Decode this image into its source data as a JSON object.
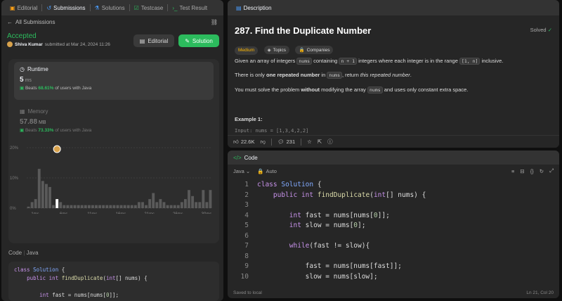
{
  "left_tabs": [
    {
      "label": "Editorial",
      "icon": "book-icon"
    },
    {
      "label": "Submissions",
      "icon": "history-icon"
    },
    {
      "label": "Solutions",
      "icon": "flask-icon"
    },
    {
      "label": "Testcase",
      "icon": "checkbox-icon"
    },
    {
      "label": "Test Result",
      "icon": "terminal-icon"
    }
  ],
  "all_submissions": "All Submissions",
  "submission": {
    "status": "Accepted",
    "author": "Shiva Kumar",
    "submitted_text": "submitted at Mar 24, 2024 11:26"
  },
  "buttons": {
    "editorial": "Editorial",
    "solution": "Solution"
  },
  "runtime": {
    "label": "Runtime",
    "value": "5",
    "unit": "ms",
    "beats_prefix": "Beats",
    "beats_pct": "68.61%",
    "beats_suffix": "of users with Java"
  },
  "memory": {
    "label": "Memory",
    "value": "57.88",
    "unit": "MB",
    "beats_prefix": "Beats",
    "beats_pct": "73.33%",
    "beats_suffix": "of users with Java"
  },
  "chart_data": {
    "type": "bar",
    "yticks": [
      "20%",
      "10%",
      "0%"
    ],
    "xticks": [
      "1ms",
      "6ms",
      "11ms",
      "16ms",
      "21ms",
      "26ms",
      "30ms"
    ],
    "mini_xticks": [
      "1ms",
      "11ms",
      "21ms",
      "31ms"
    ],
    "values": [
      0.5,
      2,
      3,
      13,
      9,
      8,
      7,
      1,
      3,
      2,
      1,
      1,
      1,
      1,
      1,
      1,
      1,
      1,
      1,
      1,
      1,
      1,
      1,
      1,
      1,
      1,
      1,
      1,
      1,
      1,
      1,
      2,
      2,
      1,
      3,
      5,
      2,
      3,
      2,
      1,
      1,
      1,
      1,
      2,
      3,
      6,
      4,
      2,
      2,
      6,
      2,
      6
    ],
    "highlight_index": 8,
    "ylim": [
      0,
      20
    ]
  },
  "code_section": {
    "label": "Code",
    "lang": "Java"
  },
  "code_preview": [
    "class Solution {",
    "    public int findDuplicate(int[] nums) {",
    "",
    "        int fast = nums[nums[0]];"
  ],
  "description": {
    "tab": "Description",
    "title": "287. Find the Duplicate Number",
    "solved": "Solved",
    "difficulty": "Medium",
    "topics": "Topics",
    "companies": "Companies",
    "p1a": "Given an array of integers",
    "p1_nums": "nums",
    "p1b": "containing",
    "p1_n1": "n + 1",
    "p1c": "integers where each integer is in the range",
    "p1_range": "[1, n]",
    "p1d": "inclusive.",
    "p2a": "There is only",
    "p2b": "one repeated number",
    "p2c": "in",
    "p2_nums": "nums",
    "p2d": ", return",
    "p2e": "this repeated number",
    "p3a": "You must solve the problem",
    "p3b": "without",
    "p3c": "modifying the array",
    "p3_nums": "nums",
    "p3d": "and uses only constant extra space.",
    "example": "Example 1:",
    "example_line": "Input: nums = [1,3,4,2,2]",
    "likes": "22.6K",
    "comments": "231"
  },
  "code_panel": {
    "title": "Code",
    "lang": "Java",
    "mode": "Auto",
    "saved": "Saved to local",
    "cursor": "Ln 21, Col 20",
    "lines": [
      "class Solution {",
      "    public int findDuplicate(int[] nums) {",
      "",
      "        int fast = nums[nums[0]];",
      "        int slow = nums[0];",
      "",
      "        while(fast != slow){",
      "",
      "            fast = nums[nums[fast]];",
      "            slow = nums[slow];"
    ],
    "line_numbers": [
      "1",
      "2",
      "3",
      "4",
      "5",
      "6",
      "7",
      "8",
      "9",
      "10"
    ]
  }
}
